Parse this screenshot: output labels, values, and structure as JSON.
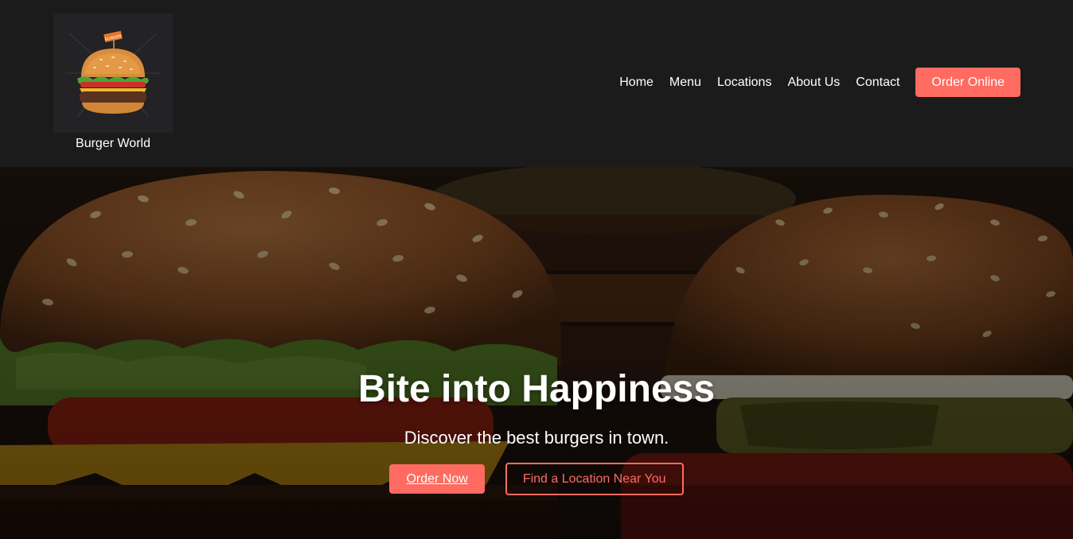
{
  "brand": {
    "name": "Burger World",
    "logo_icon": "burger-logo-icon",
    "flag_text": "BURGER"
  },
  "nav": {
    "items": [
      {
        "label": "Home"
      },
      {
        "label": "Menu"
      },
      {
        "label": "Locations"
      },
      {
        "label": "About Us"
      },
      {
        "label": "Contact"
      }
    ],
    "cta_label": "Order Online"
  },
  "hero": {
    "title": "Bite into Happiness",
    "subtitle": "Discover the best burgers in town.",
    "primary_button": "Order Now",
    "secondary_button": "Find a Location Near You",
    "background_image": "burgers-photo"
  },
  "colors": {
    "header_bg": "#1b1b1b",
    "accent": "#ff6b61",
    "text": "#ffffff"
  }
}
